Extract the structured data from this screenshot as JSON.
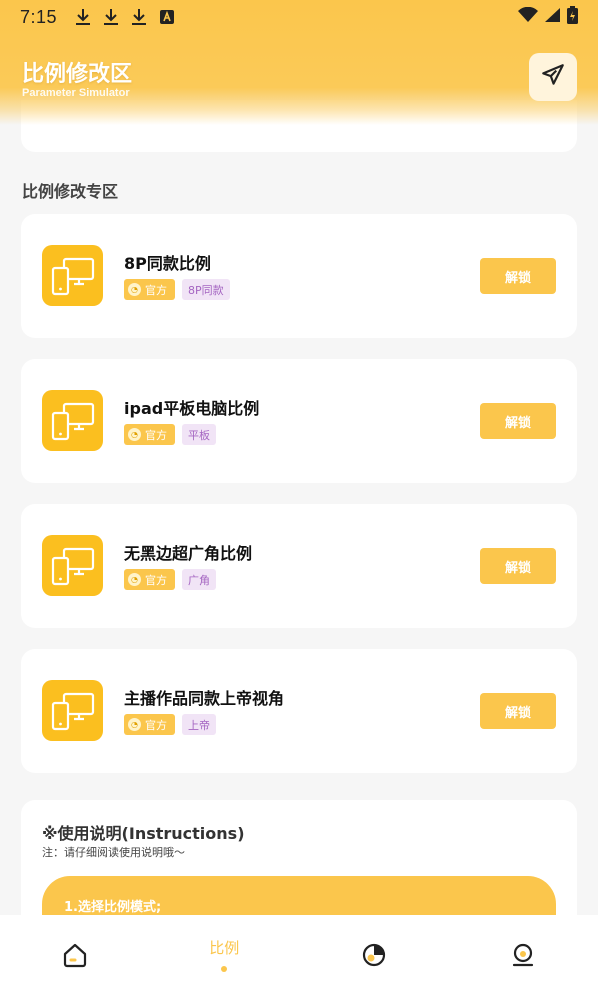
{
  "status_bar": {
    "time": "7:15",
    "icons_left": [
      "download-icon",
      "download-icon",
      "download-icon",
      "font-icon"
    ],
    "icons_right": [
      "wifi-icon",
      "signal-icon",
      "battery-icon"
    ]
  },
  "header": {
    "title": "比例修改区",
    "subtitle": "Parameter Simulator",
    "send_icon": "send-icon"
  },
  "section": {
    "title": "比例修改专区"
  },
  "cards": [
    {
      "title": "8P同款比例",
      "official": "官方",
      "tag": "8P同款",
      "button": "解锁"
    },
    {
      "title": "ipad平板电脑比例",
      "official": "官方",
      "tag": "平板",
      "button": "解锁"
    },
    {
      "title": "无黑边超广角比例",
      "official": "官方",
      "tag": "广角",
      "button": "解锁"
    },
    {
      "title": "主播作品同款上帝视角",
      "official": "官方",
      "tag": "上帝",
      "button": "解锁"
    }
  ],
  "instructions": {
    "title": "※使用说明(Instructions)",
    "note": "注：请仔细阅读使用说明哦～",
    "step1": "1.选择比例模式;"
  },
  "bottom_nav": {
    "items": [
      {
        "icon": "home-icon",
        "label": ""
      },
      {
        "icon": "",
        "label": "比例",
        "active": true
      },
      {
        "icon": "pie-chart-icon",
        "label": ""
      },
      {
        "icon": "profile-icon",
        "label": ""
      }
    ]
  },
  "colors": {
    "accent": "#fbc64c",
    "icon_bg": "#fbbf1f",
    "tag_purple_bg": "#f1e4f6",
    "tag_purple_text": "#a566c2",
    "page_bg": "#f6f6f6"
  }
}
